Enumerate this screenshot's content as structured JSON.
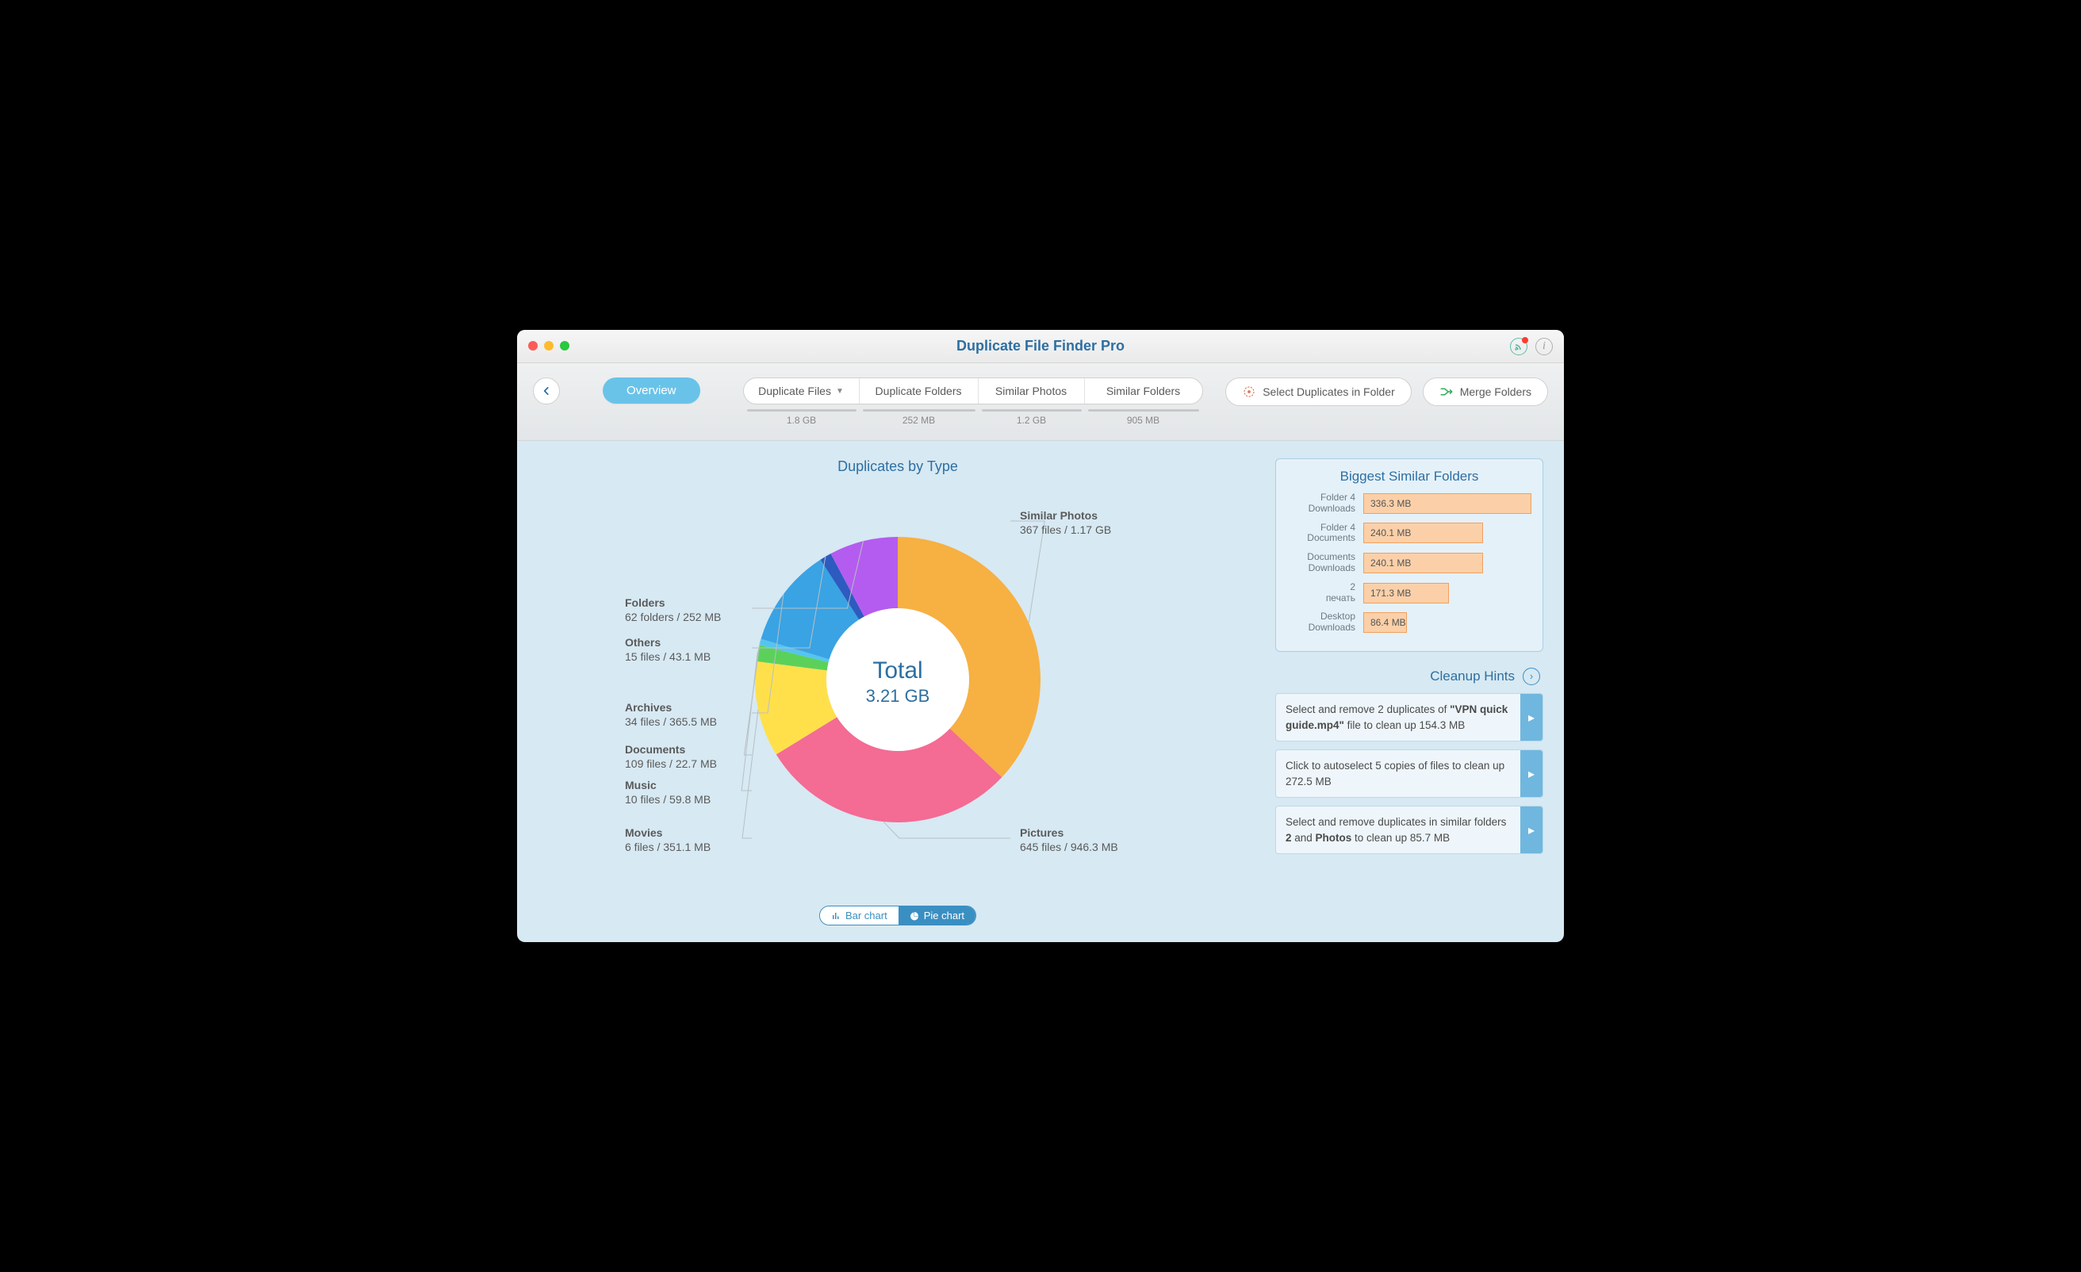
{
  "window": {
    "title": "Duplicate File Finder Pro"
  },
  "toolbar": {
    "overview": "Overview",
    "tabs": [
      {
        "label": "Duplicate Files",
        "dropdown": true,
        "size": "1.8 GB",
        "width": 146
      },
      {
        "label": "Duplicate Folders",
        "dropdown": false,
        "size": "252 MB",
        "width": 150
      },
      {
        "label": "Similar Photos",
        "dropdown": false,
        "size": "1.2 GB",
        "width": 134
      },
      {
        "label": "Similar Folders",
        "dropdown": false,
        "size": "905 MB",
        "width": 148
      }
    ],
    "select_in_folder": "Select Duplicates in Folder",
    "merge_folders": "Merge Folders"
  },
  "chart": {
    "title": "Duplicates by Type",
    "center_label": "Total",
    "center_value": "3.21 GB",
    "toggle": {
      "bar": "Bar chart",
      "pie": "Pie chart",
      "active": "pie"
    }
  },
  "chart_data": {
    "type": "pie",
    "title": "Duplicates by Type",
    "center": {
      "label": "Total",
      "value_gb": 3.21
    },
    "slices": [
      {
        "name": "Similar Photos",
        "files": 367,
        "unit": "files",
        "size_mb": 1198.1,
        "size_label": "1.17 GB",
        "color": "#f7b042"
      },
      {
        "name": "Pictures",
        "files": 645,
        "unit": "files",
        "size_mb": 946.3,
        "size_label": "946.3 MB",
        "color": "#f46b94"
      },
      {
        "name": "Movies",
        "files": 6,
        "unit": "files",
        "size_mb": 351.1,
        "size_label": "351.1 MB",
        "color": "#ffe04b"
      },
      {
        "name": "Music",
        "files": 10,
        "unit": "files",
        "size_mb": 59.8,
        "size_label": "59.8 MB",
        "color": "#5bd15b"
      },
      {
        "name": "Documents",
        "files": 109,
        "unit": "files",
        "size_mb": 22.7,
        "size_label": "22.7 MB",
        "color": "#54c5f0"
      },
      {
        "name": "Archives",
        "files": 34,
        "unit": "files",
        "size_mb": 365.5,
        "size_label": "365.5 MB",
        "color": "#3aa3e3"
      },
      {
        "name": "Others",
        "files": 15,
        "unit": "files",
        "size_mb": 43.1,
        "size_label": "43.1 MB",
        "color": "#2d5bbf"
      },
      {
        "name": "Folders",
        "files": 62,
        "unit": "folders",
        "size_mb": 252.0,
        "size_label": "252 MB",
        "color": "#b45cf0"
      }
    ]
  },
  "biggest_panel": {
    "title": "Biggest Similar Folders",
    "rows": [
      {
        "label_a": "Folder 4",
        "label_b": "Downloads",
        "size": "336.3 MB",
        "pct": 100
      },
      {
        "label_a": "Folder 4",
        "label_b": "Documents",
        "size": "240.1 MB",
        "pct": 71
      },
      {
        "label_a": "Documents",
        "label_b": "Downloads",
        "size": "240.1 MB",
        "pct": 71
      },
      {
        "label_a": "2",
        "label_b": "печать",
        "size": "171.3 MB",
        "pct": 51
      },
      {
        "label_a": "Desktop",
        "label_b": "Downloads",
        "size": "86.4 MB",
        "pct": 26
      }
    ]
  },
  "hints": {
    "title": "Cleanup Hints",
    "cards": [
      {
        "html": "Select and remove 2 duplicates of <b>\"VPN quick guide.mp4\"</b> file to clean up 154.3 MB"
      },
      {
        "html": "Click to autoselect 5 copies of files to clean up 272.5 MB"
      },
      {
        "html": "Select and remove duplicates in similar folders <b>2</b> and <b>Photos</b> to clean up 85.7 MB"
      }
    ]
  }
}
